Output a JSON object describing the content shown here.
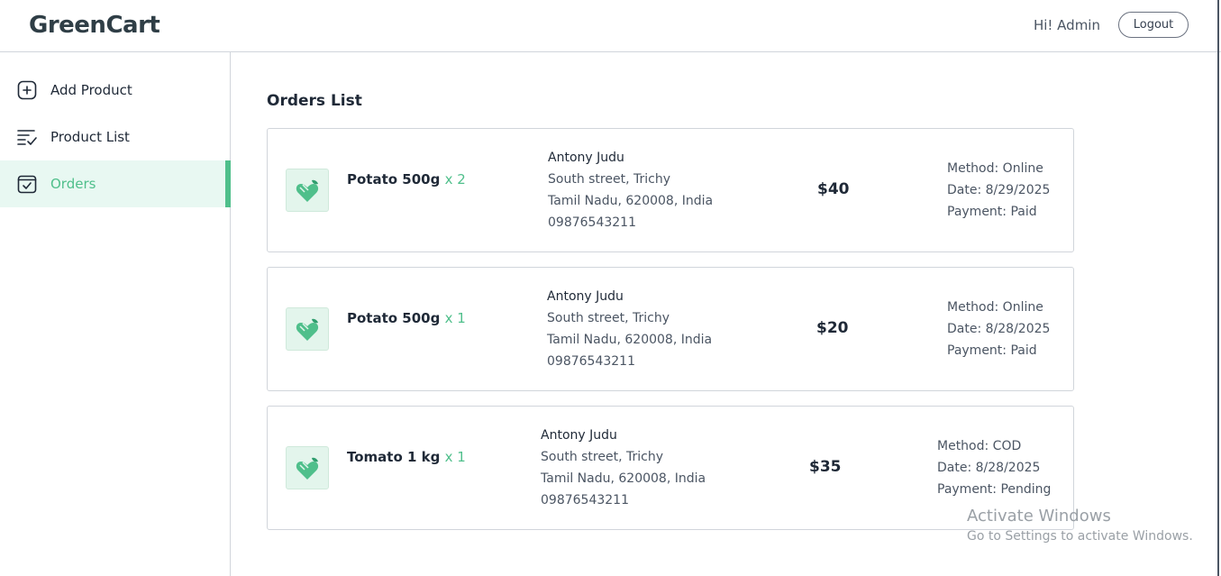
{
  "header": {
    "logo_text": "GreenCart",
    "greeting": "Hi! Admin",
    "logout_label": "Logout"
  },
  "sidebar": {
    "items": [
      {
        "label": "Add Product",
        "icon": "add-square-icon",
        "active": false
      },
      {
        "label": "Product List",
        "icon": "list-check-icon",
        "active": false
      },
      {
        "label": "Orders",
        "icon": "order-check-icon",
        "active": true
      }
    ]
  },
  "main": {
    "title": "Orders List",
    "orders": [
      {
        "item": "Potato 500g",
        "qty": "x 2",
        "customer": "Antony Judu",
        "street": "South street, Trichy",
        "region": "Tamil Nadu, 620008, India",
        "phone": "09876543211",
        "amount": "$40",
        "method": "Method: Online",
        "date": "Date: 8/29/2025",
        "payment": "Payment: Paid"
      },
      {
        "item": "Potato 500g",
        "qty": "x 1",
        "customer": "Antony Judu",
        "street": "South street, Trichy",
        "region": "Tamil Nadu, 620008, India",
        "phone": "09876543211",
        "amount": "$20",
        "method": "Method: Online",
        "date": "Date: 8/28/2025",
        "payment": "Payment: Paid"
      },
      {
        "item": "Tomato 1 kg",
        "qty": "x 1",
        "customer": "Antony Judu",
        "street": "South street, Trichy",
        "region": "Tamil Nadu, 620008, India",
        "phone": "09876543211",
        "amount": "$35",
        "method": "Method: COD",
        "date": "Date: 8/28/2025",
        "payment": "Payment: Pending"
      }
    ]
  },
  "watermark": {
    "line1": "Activate Windows",
    "line2": "Go to Settings to activate Windows."
  },
  "colors": {
    "accent": "#4fbf8b",
    "active_bg": "#e8f8f2",
    "border": "#d1d5db"
  }
}
